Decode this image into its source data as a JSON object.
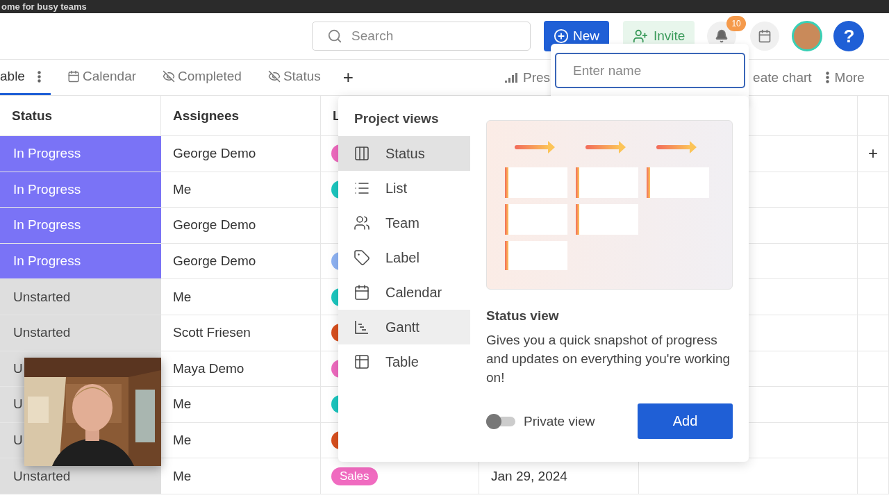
{
  "app_bar": {
    "title": "ome for busy teams"
  },
  "header": {
    "search": {
      "placeholder": "Search"
    },
    "new_button": "New",
    "invite_button": "Invite",
    "notifications": {
      "badge": "10"
    },
    "help_button": "?"
  },
  "view_tabs": [
    {
      "label": "able",
      "kind": "table",
      "selected": true
    },
    {
      "label": "Calendar",
      "kind": "calendar",
      "selected": false
    },
    {
      "label": "Completed",
      "kind": "hidden",
      "selected": false
    },
    {
      "label": "Status",
      "kind": "hidden",
      "selected": false
    }
  ],
  "add_tab": "+",
  "toolbar_right": [
    {
      "label": "Pres",
      "kind": "chart"
    },
    {
      "label": "eate chart",
      "kind": "plain"
    },
    {
      "label": "More",
      "kind": "more"
    }
  ],
  "name_field": {
    "placeholder": "Enter name"
  },
  "table": {
    "columns": [
      "Status",
      "Assignees",
      "L"
    ],
    "add_column": "+",
    "rows": [
      {
        "status": "In Progress",
        "kind": "progress",
        "assignee": "George Demo",
        "label": {
          "color": "#f06bc0"
        }
      },
      {
        "status": "In Progress",
        "kind": "progress",
        "assignee": "Me",
        "label": {
          "color": "#1cc8c0"
        }
      },
      {
        "status": "In Progress",
        "kind": "progress",
        "assignee": "George Demo"
      },
      {
        "status": "In Progress",
        "kind": "progress",
        "assignee": "George Demo",
        "label": {
          "color": "#8fb4f5"
        }
      },
      {
        "status": "Unstarted",
        "kind": "unstarted",
        "assignee": "Me",
        "label": {
          "color": "#1cc8c0"
        }
      },
      {
        "status": "Unstarted",
        "kind": "unstarted",
        "assignee": "Scott Friesen",
        "label": {
          "color": "#d9501f"
        }
      },
      {
        "status": "U",
        "kind": "unstarted",
        "assignee": "Maya Demo",
        "label": {
          "color": "#f06bc0"
        }
      },
      {
        "status": "U",
        "kind": "unstarted",
        "assignee": "Me",
        "label": {
          "color": "#1cc8c0"
        }
      },
      {
        "status": "U",
        "kind": "unstarted",
        "assignee": "Me",
        "label": {
          "color": "#d9501f"
        }
      },
      {
        "status": "Unstarted",
        "kind": "unstarted",
        "assignee": "Me",
        "label": {
          "text": "Sales",
          "color": "#f06bc0"
        },
        "date": "Jan 29, 2024"
      }
    ]
  },
  "project_views": {
    "title": "Project views",
    "items": [
      {
        "label": "Status",
        "selected": true,
        "hovered": false
      },
      {
        "label": "List",
        "selected": false,
        "hovered": false
      },
      {
        "label": "Team",
        "selected": false,
        "hovered": false
      },
      {
        "label": "Label",
        "selected": false,
        "hovered": false
      },
      {
        "label": "Calendar",
        "selected": false,
        "hovered": false
      },
      {
        "label": "Gantt",
        "selected": false,
        "hovered": true
      },
      {
        "label": "Table",
        "selected": false,
        "hovered": false
      }
    ],
    "preview": {
      "title": "Status view",
      "description": "Gives you a quick snapshot of progress and updates on everything you're working on!"
    },
    "private_view": {
      "label": "Private view",
      "on": false
    },
    "add_button": "Add"
  }
}
